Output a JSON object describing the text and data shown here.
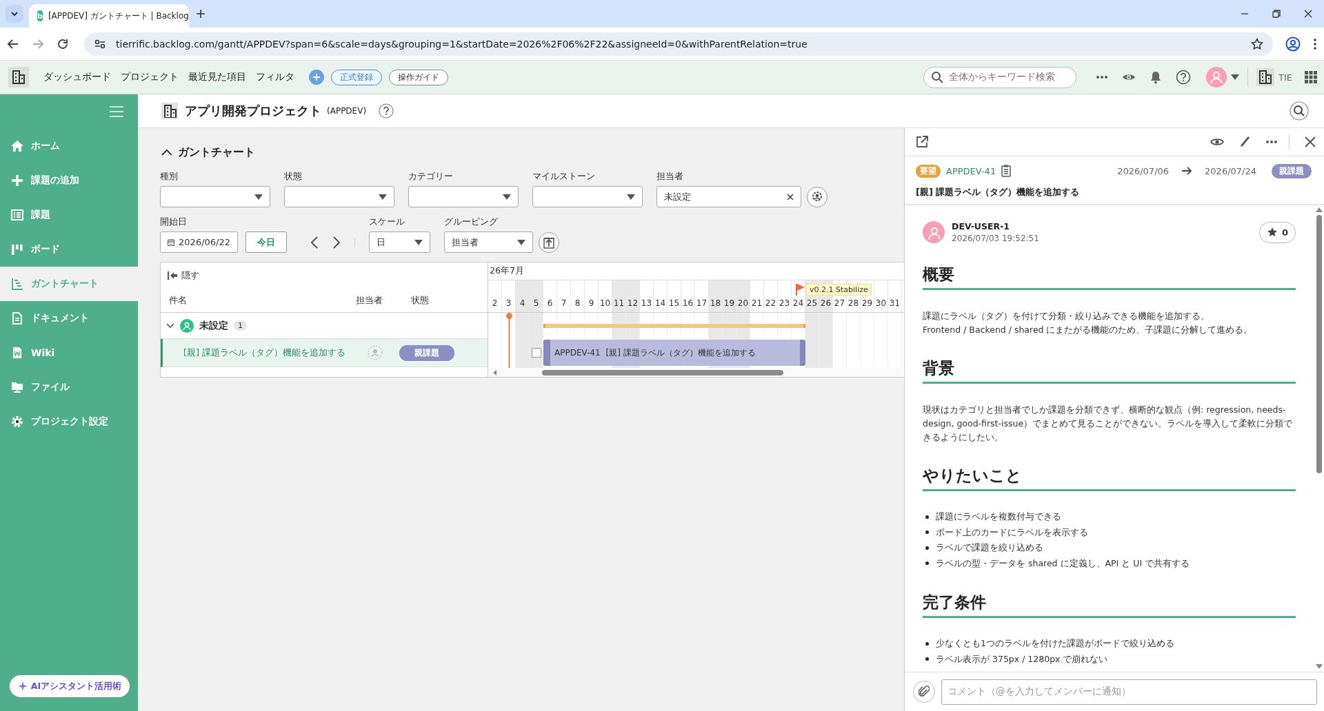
{
  "browser": {
    "favicon": "b",
    "tab_title": "[APPDEV] ガントチャート | Backlog",
    "url": "tierrific.backlog.com/gantt/APPDEV?span=6&scale=days&grouping=1&startDate=2026%2F06%2F22&assigneeId=0&withParentRelation=true"
  },
  "app_header": {
    "nav": [
      "ダッシュボード",
      "プロジェクト",
      "最近見た項目",
      "フィルタ"
    ],
    "register_button": "正式登録",
    "guide_button": "操作ガイド",
    "search": {
      "placeholder": "全体からキーワード検索"
    },
    "space_name": "TIE"
  },
  "sidebar": {
    "items": [
      {
        "label": "ホーム",
        "kind": "home",
        "selected": false
      },
      {
        "label": "課題の追加",
        "kind": "add",
        "selected": false
      },
      {
        "label": "課題",
        "kind": "list",
        "selected": false
      },
      {
        "label": "ボード",
        "kind": "board",
        "selected": false
      },
      {
        "label": "ガントチャート",
        "kind": "gantt",
        "selected": true
      },
      {
        "label": "ドキュメント",
        "kind": "document",
        "selected": false
      },
      {
        "label": "Wiki",
        "kind": "wiki",
        "selected": false
      },
      {
        "label": "ファイル",
        "kind": "file",
        "selected": false
      },
      {
        "label": "プロジェクト設定",
        "kind": "settings",
        "selected": false
      }
    ],
    "ai_button": "AIアシスタント活用術"
  },
  "project": {
    "title": "アプリ開発プロジェクト",
    "key": "(APPDEV)"
  },
  "gantt": {
    "title": "ガントチャート",
    "expanded": true,
    "filters": [
      {
        "label": "種別"
      },
      {
        "label": "状態"
      },
      {
        "label": "カテゴリー"
      },
      {
        "label": "マイルストーン"
      }
    ],
    "assignee": {
      "label": "担当者",
      "value": "未設定"
    },
    "start_date": {
      "label": "開始日",
      "value": "2026/06/22"
    },
    "today_button": "今日",
    "scale": {
      "label": "スケール",
      "value": "日"
    },
    "grouping": {
      "label": "グルーピング",
      "value": "担当者"
    },
    "table": {
      "hide_button": "隠す",
      "columns": [
        "件名",
        "担当者",
        "状態"
      ],
      "month": "26年7月",
      "milestone": "v0.2.1 Stabilize",
      "days": [
        {
          "label": "2",
          "shaded": false,
          "today": false,
          "in_span": false,
          "milestone": false
        },
        {
          "label": "3",
          "shaded": false,
          "today": true,
          "in_span": false,
          "milestone": false
        },
        {
          "label": "4",
          "shaded": true,
          "today": false,
          "in_span": false,
          "milestone": false
        },
        {
          "label": "5",
          "shaded": true,
          "today": false,
          "in_span": false,
          "milestone": false
        },
        {
          "label": "6",
          "shaded": false,
          "today": false,
          "in_span": true,
          "milestone": false
        },
        {
          "label": "7",
          "shaded": false,
          "today": false,
          "in_span": true,
          "milestone": false
        },
        {
          "label": "8",
          "shaded": false,
          "today": false,
          "in_span": true,
          "milestone": false
        },
        {
          "label": "9",
          "shaded": false,
          "today": false,
          "in_span": true,
          "milestone": false
        },
        {
          "label": "10",
          "shaded": false,
          "today": false,
          "in_span": true,
          "milestone": false
        },
        {
          "label": "11",
          "shaded": true,
          "today": false,
          "in_span": true,
          "milestone": false
        },
        {
          "label": "12",
          "shaded": true,
          "today": false,
          "in_span": true,
          "milestone": false
        },
        {
          "label": "13",
          "shaded": false,
          "today": false,
          "in_span": true,
          "milestone": false
        },
        {
          "label": "14",
          "shaded": false,
          "today": false,
          "in_span": true,
          "milestone": false
        },
        {
          "label": "15",
          "shaded": false,
          "today": false,
          "in_span": true,
          "milestone": false
        },
        {
          "label": "16",
          "shaded": false,
          "today": false,
          "in_span": true,
          "milestone": false
        },
        {
          "label": "17",
          "shaded": false,
          "today": false,
          "in_span": true,
          "milestone": false
        },
        {
          "label": "18",
          "shaded": true,
          "today": false,
          "in_span": true,
          "milestone": false
        },
        {
          "label": "19",
          "shaded": true,
          "today": false,
          "in_span": true,
          "milestone": false
        },
        {
          "label": "20",
          "shaded": true,
          "today": false,
          "in_span": true,
          "milestone": false
        },
        {
          "label": "21",
          "shaded": false,
          "today": false,
          "in_span": true,
          "milestone": false
        },
        {
          "label": "22",
          "shaded": false,
          "today": false,
          "in_span": true,
          "milestone": false
        },
        {
          "label": "23",
          "shaded": false,
          "today": false,
          "in_span": true,
          "milestone": false
        },
        {
          "label": "24",
          "shaded": false,
          "today": false,
          "in_span": true,
          "milestone": true
        },
        {
          "label": "25",
          "shaded": true,
          "today": false,
          "in_span": false,
          "milestone": false
        },
        {
          "label": "26",
          "shaded": true,
          "today": false,
          "in_span": false,
          "milestone": false
        },
        {
          "label": "27",
          "shaded": false,
          "today": false,
          "in_span": false,
          "milestone": false
        },
        {
          "label": "28",
          "shaded": false,
          "today": false,
          "in_span": false,
          "milestone": false
        },
        {
          "label": "29",
          "shaded": false,
          "today": false,
          "in_span": false,
          "milestone": false
        },
        {
          "label": "30",
          "shaded": false,
          "today": false,
          "in_span": false,
          "milestone": false
        },
        {
          "label": "31",
          "shaded": false,
          "today": false,
          "in_span": false,
          "milestone": false
        }
      ],
      "groups": [
        {
          "name": "未設定",
          "count": "1",
          "expanded": true,
          "issues": [
            {
              "title": "[親] 課題ラベル（タグ）機能を追加する",
              "status": "親課題",
              "selected": true,
              "checked": false,
              "bar_key": "APPDEV-41",
              "bar_title": "[親] 課題ラベル（タグ）機能を追加する"
            }
          ]
        }
      ]
    }
  },
  "detail": {
    "type_tag": "要望",
    "issue_key": "APPDEV-41",
    "start_date": "2026/07/06",
    "due_date": "2026/07/24",
    "status": "親課題",
    "title": "[親] 課題ラベル（タグ）機能を追加する",
    "author": "DEV-USER-1",
    "created": "2026/07/03 19:52:51",
    "star_count": "0",
    "sections": [
      {
        "heading": "概要",
        "kind": "paragraph",
        "lines": [
          "課題にラベル（タグ）を付けて分類・絞り込みできる機能を追加する。",
          "Frontend / Backend / shared にまたがる機能のため、子課題に分解して進める。"
        ]
      },
      {
        "heading": "背景",
        "kind": "paragraph",
        "lines": [
          "現状はカテゴリと担当者でしか課題を分類できず、横断的な観点（例: regression, needs-design, good-first-issue）でまとめて見ることができない。ラベルを導入して柔軟に分類できるようにしたい。"
        ]
      },
      {
        "heading": "やりたいこと",
        "kind": "bullets",
        "lines": [
          "課題にラベルを複数付与できる",
          "ボード上のカードにラベルを表示する",
          "ラベルで課題を絞り込める",
          "ラベルの型・データを shared に定義し、API と UI で共有する"
        ]
      },
      {
        "heading": "完了条件",
        "kind": "bullets",
        "lines": [
          "少なくとも1つのラベルを付けた課題がボードで絞り込める",
          "ラベル表示が 375px / 1280px で崩れない"
        ]
      }
    ],
    "comment": {
      "placeholder": "コメント（@を入力してメンバーに通知）"
    }
  }
}
